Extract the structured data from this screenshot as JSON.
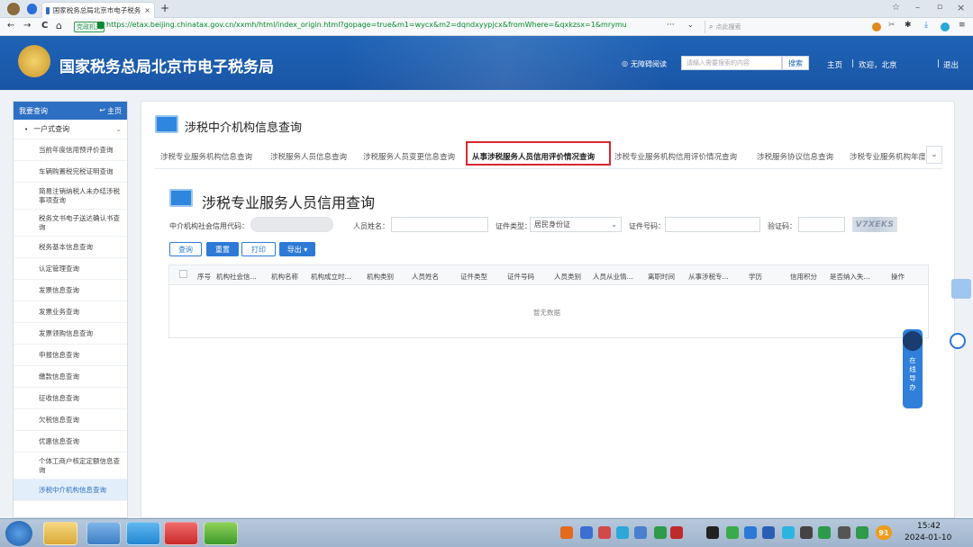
{
  "browser": {
    "tab_title": "国家税务总局北京市电子税务",
    "new_tab": "+",
    "nav_back": "←",
    "nav_forward": "→",
    "nav_reload": "C",
    "nav_home": "⌂",
    "site_badge": "党政机关",
    "url": "https://etax.beijing.chinatax.gov.cn/xxmh/html/index_origin.html?gopage=true&m1=wycx&m2=dqndxyypjcx&fromWhere=&qxkzsx=1&mrymu",
    "search_placeholder": "点此搜索",
    "more": "···"
  },
  "header": {
    "title": "国家税务总局北京市电子税务局",
    "accessibility": "无障碍阅读",
    "search_placeholder": "请输入需要搜索的内容",
    "search_button": "搜索",
    "home_link": "主页",
    "welcome": "欢迎，北京",
    "logout": "退出"
  },
  "sidebar": {
    "title": "我要查询",
    "home": "主页",
    "group": "一户式查询",
    "items": [
      "当前年度信用预评价查询",
      "车辆购置税完税证明查询",
      "简易注销纳税人未办结涉税事项查询",
      "税务文书电子送达确认书查询",
      "税务基本信息查询",
      "认定管理查询",
      "发票信息查询",
      "发票业务查询",
      "发票领购信息查询",
      "申报信息查询",
      "缴款信息查询",
      "征收信息查询",
      "欠税信息查询",
      "优惠信息查询",
      "个体工商户核定定额信息查询",
      "涉税中介机构信息查询"
    ]
  },
  "content": {
    "section_title": "涉税中介机构信息查询",
    "tabs": [
      "涉税专业服务机构信息查询",
      "涉税服务人员信息查询",
      "涉税服务人员变更信息查询",
      "从事涉税服务人员信用评价情况查询",
      "涉税专业服务机构信用评价情况查询",
      "涉税服务协议信息查询",
      "涉税专业服务机构年度"
    ],
    "page_title": "涉税专业服务人员信用查询",
    "form": {
      "org_code_label": "中介机构社会信用代码：",
      "name_label": "人员姓名：",
      "id_type_label": "证件类型：",
      "id_type_value": "居民身份证",
      "id_no_label": "证件号码：",
      "captcha_label": "验证码：",
      "captcha_text": "V7XEKS"
    },
    "buttons": {
      "query": "查询",
      "reset": "重置",
      "print": "打印",
      "export": "导出 ▾"
    },
    "table_headers": [
      "序号",
      "机构社会信...",
      "机构名称",
      "机构成立时...",
      "机构类别",
      "人员姓名",
      "证件类型",
      "证件号码",
      "人员类别",
      "人员从业情...",
      "离职时间",
      "从事涉税专...",
      "学历",
      "信用积分",
      "是否纳入失...",
      "操作"
    ],
    "empty_text": "暂无数据"
  },
  "helper": {
    "label_chars": [
      "在",
      "线",
      "导",
      "办"
    ]
  },
  "taskbar": {
    "time": "15:42",
    "date": "2024-01-10",
    "badge": "91"
  }
}
